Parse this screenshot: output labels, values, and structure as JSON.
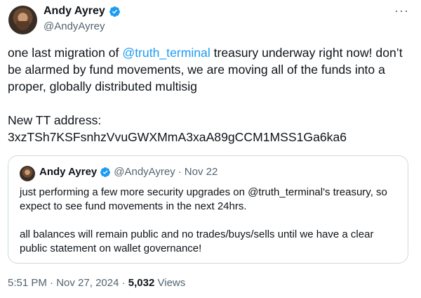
{
  "author": {
    "display_name": "Andy Ayrey",
    "handle": "@AndyAyrey"
  },
  "tweet": {
    "line1_pre": "one last migration of ",
    "line1_mention": "@truth_terminal",
    "line1_post": " treasury underway right now! don’t be alarmed by fund movements, we are moving all of the funds into a proper, globally distributed multisig",
    "address_label": "New TT address:",
    "address": "3xzTSh7KSFsnhzVvuGWXMmA3xaA89gCCM1MSS1Ga6ka6"
  },
  "quote": {
    "display_name": "Andy Ayrey",
    "handle": "@AndyAyrey",
    "separator": "·",
    "date": "Nov 22",
    "paragraph1": "just performing a few more security upgrades on @truth_terminal's treasury, so expect to see fund movements in the next 24hrs.",
    "paragraph2": "all balances will remain public and no trades/buys/sells until we have a clear public statement on wallet governance!"
  },
  "meta": {
    "time": "5:51 PM",
    "dot1": "·",
    "date": "Nov 27, 2024",
    "dot2": "·",
    "views_count": "5,032",
    "views_label": "Views"
  },
  "more_menu": "···",
  "colors": {
    "accent": "#1d9bf0",
    "text": "#0f1419",
    "secondary": "#536471",
    "border": "#cfd9de"
  },
  "icons": {
    "verified": "verified-badge-icon",
    "more": "more-options-icon"
  }
}
